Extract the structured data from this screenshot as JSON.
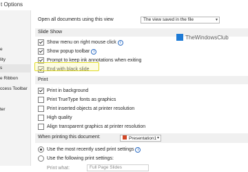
{
  "window": {
    "title": "t Options"
  },
  "sidebar": {
    "items": [
      {
        "label": "e"
      },
      {
        "label": "lity"
      },
      {
        "label": "s"
      },
      {
        "label": "e Ribbon"
      },
      {
        "label": "ccess Toolbar"
      },
      {
        "label": "ter"
      }
    ]
  },
  "open_docs": {
    "label": "Open all documents using this view",
    "value": "The view saved in the file"
  },
  "slide_show": {
    "header": "Slide Show",
    "options": [
      {
        "label": "Show menu on right mouse click",
        "checked": true,
        "info": true
      },
      {
        "label": "Show popup toolbar",
        "checked": true,
        "info": true
      },
      {
        "label": "Prompt to keep ink annotations when exiting",
        "checked": true,
        "info": false
      },
      {
        "label": "End with black slide",
        "checked": true,
        "info": false
      }
    ]
  },
  "print": {
    "header": "Print",
    "options": [
      {
        "label": "Print in background",
        "checked": true
      },
      {
        "label": "Print TrueType fonts as graphics",
        "checked": false
      },
      {
        "label": "Print inserted objects at printer resolution",
        "checked": false
      },
      {
        "label": "High quality",
        "checked": false
      },
      {
        "label": "Align transparent graphics at printer resolution",
        "checked": false
      }
    ]
  },
  "print_doc": {
    "header": "When printing this document:",
    "doc_name": "Presentation1",
    "radio_recent": "Use the most recently used print settings",
    "radio_following": "Use the following print settings:",
    "print_what_label": "Print what:",
    "print_what_value": "Full Page Slides"
  },
  "watermark": {
    "text": "TheWindowsClub"
  },
  "colors": {
    "highlight": "#e0dc2a",
    "accent": "#2b6cc4",
    "logo": "#1e7bd6"
  }
}
